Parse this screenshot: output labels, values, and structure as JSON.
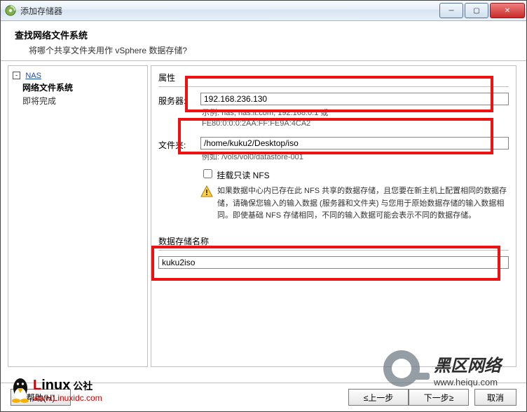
{
  "window": {
    "title": "添加存储器"
  },
  "header": {
    "title": "查找网络文件系统",
    "subtitle": "将哪个共享文件夹用作 vSphere 数据存储?"
  },
  "nav": {
    "root": "NAS",
    "l1": "网络文件系统",
    "l2": "即将完成"
  },
  "props": {
    "section_label": "属性",
    "server_label": "服务器:",
    "server_value": "192.168.236.130",
    "server_hint1": "示例: nas, nas.it.com, 192.168.0.1 或",
    "server_hint2": "FE80:0:0:0:2AA:FF:FE9A:4CA2",
    "folder_label": "文件夹:",
    "folder_value": "/home/kuku2/Desktop/iso",
    "folder_hint": "例如: /vols/vol0/datastore-001",
    "mount_ro_label": "挂载只读 NFS",
    "warn_text": "如果数据中心内已存在此 NFS 共享的数据存储，且您要在新主机上配置相同的数据存储，请确保您输入的输入数据 (服务器和文件夹) 与您用于原始数据存储的输入数据相同。即使基础 NFS 存储相同，不同的输入数据可能会表示不同的数据存储。"
  },
  "ds": {
    "section_label": "数据存储名称",
    "name_value": "kuku2iso"
  },
  "buttons": {
    "help": "帮助(H)",
    "back": "≤上一步",
    "next": "下一步≥",
    "cancel": "取消"
  },
  "watermark": {
    "brand": "黑区网络",
    "domain": "www.heiqu.com",
    "linux_brand": "Linux 公社",
    "linux_domain": "www.Linuxidc.com"
  }
}
